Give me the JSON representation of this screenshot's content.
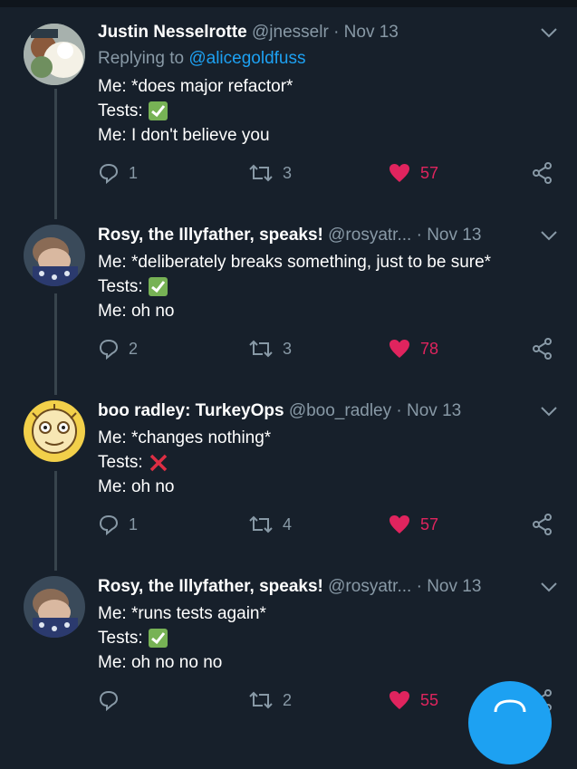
{
  "tweets": [
    {
      "name": "Justin Nesselrotte",
      "handle": "@jnesselr",
      "date": "Nov 13",
      "reply_label": "Replying to",
      "reply_mention": "@alicegoldfuss",
      "lines": [
        "Me: *does major refactor*",
        "Tests:",
        "Me: I don't believe you"
      ],
      "tests_emoji": "check-mark-icon",
      "replies": "1",
      "retweets": "3",
      "likes": "57"
    },
    {
      "name": "Rosy, the Illyfather, speaks!",
      "handle": "@rosyatr...",
      "date": "Nov 13",
      "lines": [
        "Me: *deliberately breaks something, just to be sure*",
        "Tests:",
        "Me: oh no"
      ],
      "tests_emoji": "check-mark-icon",
      "replies": "2",
      "retweets": "3",
      "likes": "78"
    },
    {
      "name": "boo radley: TurkeyOps",
      "handle": "@boo_radley",
      "date": "Nov 13",
      "lines": [
        "Me: *changes nothing*",
        "Tests:",
        "Me: oh no"
      ],
      "tests_emoji": "cross-mark-icon",
      "replies": "1",
      "retweets": "4",
      "likes": "57"
    },
    {
      "name": "Rosy, the Illyfather, speaks!",
      "handle": "@rosyatr...",
      "date": "Nov 13",
      "lines": [
        "Me: *runs tests again*",
        "Tests:",
        "Me: oh no no no"
      ],
      "tests_emoji": "check-mark-icon",
      "replies": "",
      "retweets": "2",
      "likes": "55"
    }
  ],
  "separator": "·",
  "colors": {
    "background": "#17202b",
    "secondary_text": "#8899a6",
    "link": "#1da1f2",
    "like": "#e0245e",
    "thread_line": "#38444d",
    "check": "#77b255",
    "cross": "#dd2e44"
  },
  "fab_icon": "compose-icon"
}
